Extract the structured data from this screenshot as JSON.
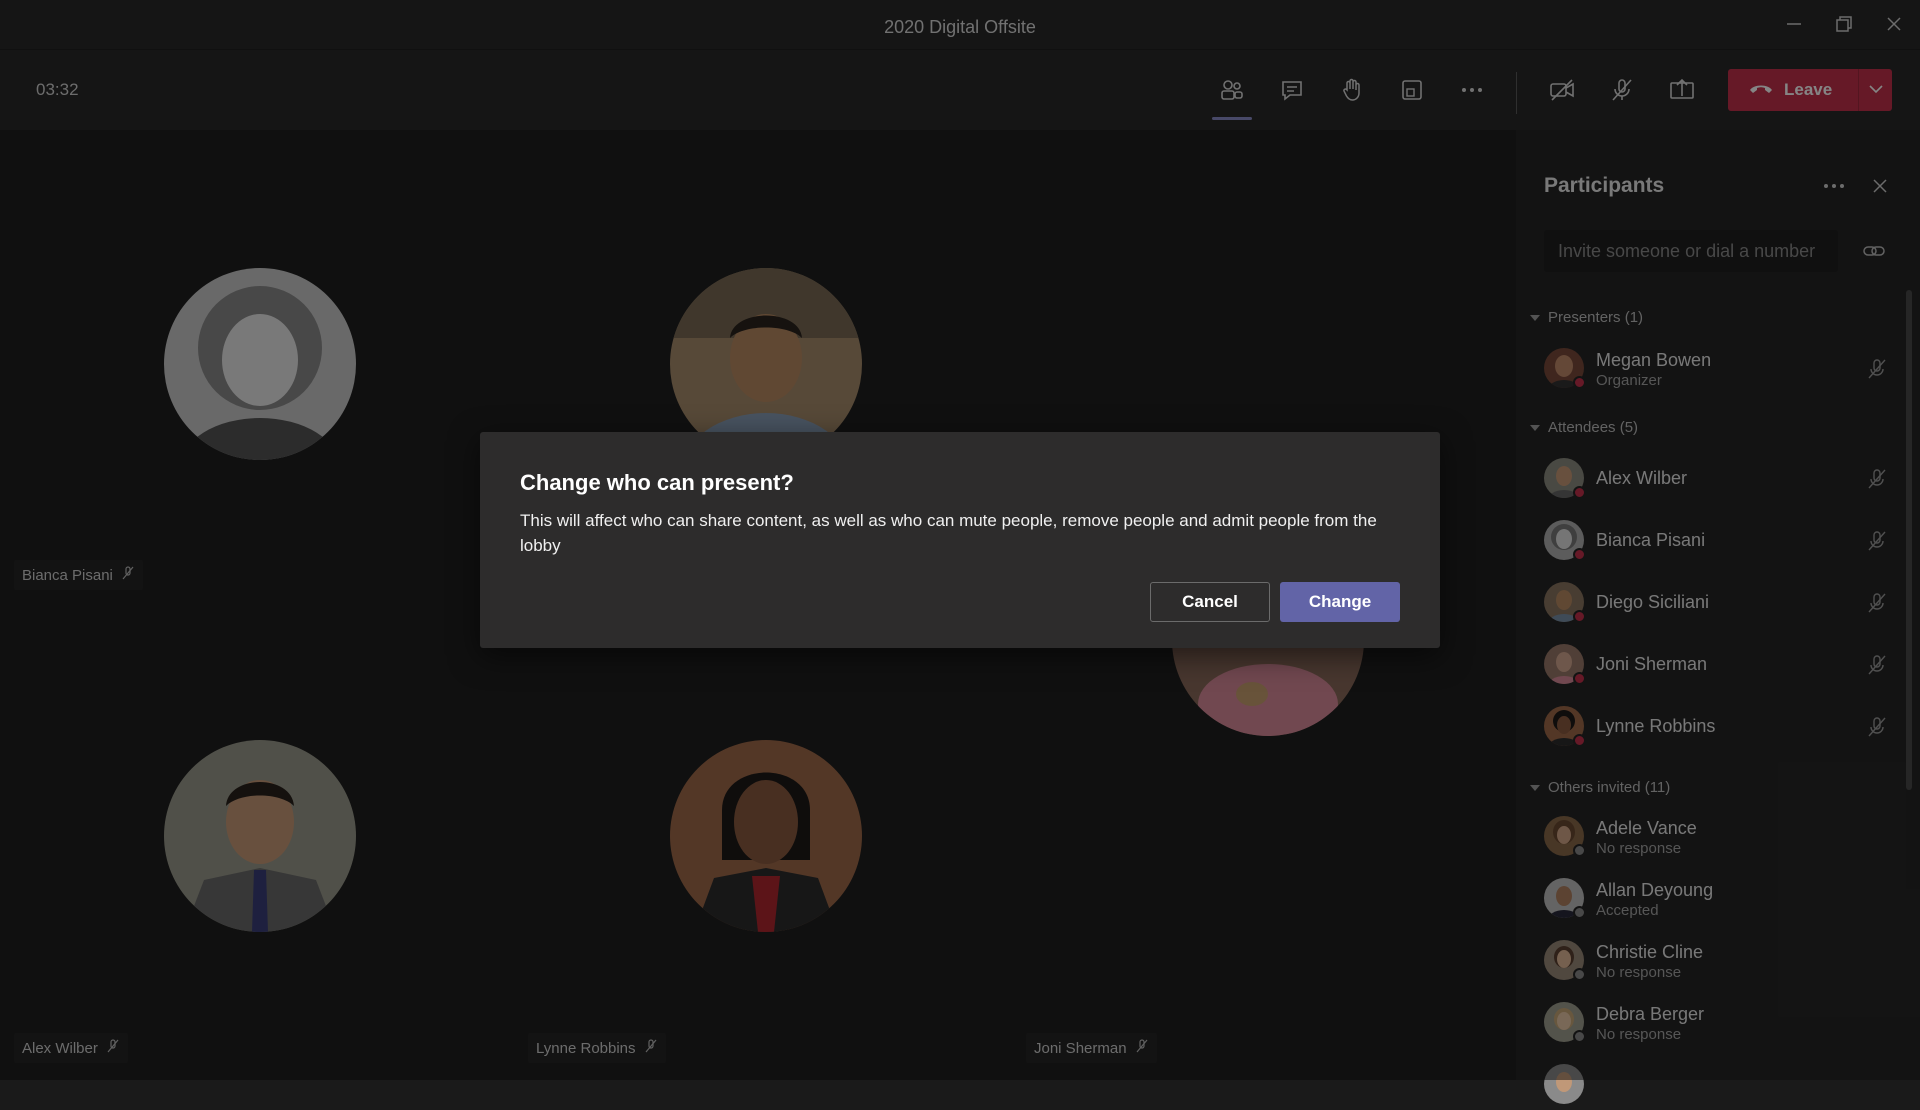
{
  "window": {
    "title": "2020 Digital Offsite"
  },
  "toolbar": {
    "timer": "03:32",
    "leave_label": "Leave",
    "icons": [
      "participants-icon",
      "chat-icon",
      "raise-hand-icon",
      "focus-icon",
      "more-icon",
      "camera-off-icon",
      "mic-off-icon",
      "share-tray-icon"
    ],
    "leave_color": "#c4314b"
  },
  "stage": {
    "tiles": [
      {
        "name": "Bianca Pisani"
      },
      {
        "name": "Alex Wilber"
      },
      {
        "name": "Lynne Robbins"
      },
      {
        "name": "Joni Sherman"
      }
    ]
  },
  "panel": {
    "title": "Participants",
    "invite_placeholder": "Invite someone or dial a number",
    "presenters_heading": "Presenters (1)",
    "presenters": [
      {
        "name": "Megan Bowen",
        "role": "Organizer"
      }
    ],
    "attendees_heading": "Attendees (5)",
    "attendees": [
      {
        "name": "Alex Wilber"
      },
      {
        "name": "Bianca Pisani"
      },
      {
        "name": "Diego Siciliani"
      },
      {
        "name": "Joni Sherman"
      },
      {
        "name": "Lynne Robbins"
      }
    ],
    "others_heading": "Others invited (11)",
    "others": [
      {
        "name": "Adele Vance",
        "status": "No response"
      },
      {
        "name": "Allan Deyoung",
        "status": "Accepted"
      },
      {
        "name": "Christie Cline",
        "status": "No response"
      },
      {
        "name": "Debra Berger",
        "status": "No response"
      }
    ]
  },
  "dialog": {
    "title": "Change who can present?",
    "body": "This will affect who can share content, as well as who can mute people, remove people and admit people from the lobby",
    "cancel_label": "Cancel",
    "confirm_label": "Change",
    "accent": "#6264a7"
  }
}
